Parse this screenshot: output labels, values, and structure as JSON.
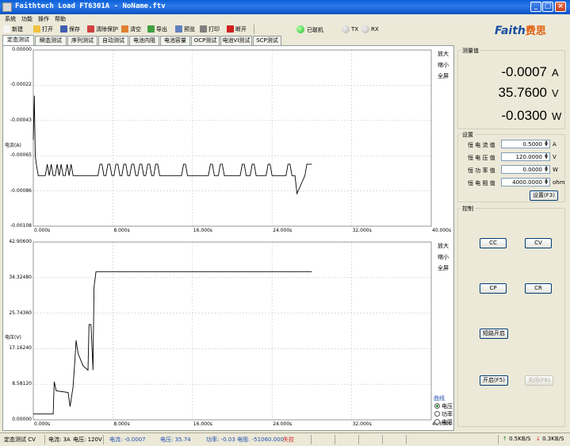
{
  "window": {
    "title": "Faithtech Load FT6301A - NoName.ftv"
  },
  "menu": {
    "items": [
      "系统",
      "功能",
      "操作",
      "帮助"
    ]
  },
  "toolbar": {
    "buttons": [
      {
        "label": "新建",
        "icon": "new-file-icon",
        "color": "#f5f5f5"
      },
      {
        "label": "打开",
        "icon": "open-folder-icon",
        "color": "#f0c040"
      },
      {
        "label": "保存",
        "icon": "save-disk-icon",
        "color": "#4060b0"
      },
      {
        "label": "清除保护",
        "icon": "clear-protect-icon",
        "color": "#d04040"
      },
      {
        "label": "清空",
        "icon": "clear-icon",
        "color": "#e08030"
      },
      {
        "label": "导出",
        "icon": "export-icon",
        "color": "#40a040"
      },
      {
        "label": "预览",
        "icon": "preview-icon",
        "color": "#6080c0"
      },
      {
        "label": "打印",
        "icon": "print-icon",
        "color": "#808080"
      },
      {
        "label": "断开",
        "icon": "disconnect-icon",
        "color": "#d02020"
      }
    ],
    "connected_label": "已联机",
    "tx_label": "TX",
    "rx_label": "RX",
    "led_connected_color": "#20c020",
    "led_idle_color": "#b0b0b0"
  },
  "logo": {
    "text": "Faith",
    "cn": "费思"
  },
  "tabs": [
    "定态测试",
    "瞬态测试",
    "序列测试",
    "自动测试",
    "电池内阻",
    "电池容量",
    "OCP测试",
    "电池VI测试",
    "SCP测试"
  ],
  "active_tab": 0,
  "zoom": {
    "zoom_in": "放大",
    "zoom_out": "缩小",
    "full_screen": "全屏"
  },
  "chart_data": [
    {
      "type": "line",
      "title": "",
      "ylabel": "电流(A)",
      "xlabel": "",
      "x_ticks": [
        "0.000s",
        "8.000s",
        "16.000s",
        "24.000s",
        "32.000s",
        "40.000s"
      ],
      "y_ticks": [
        "0.00000",
        "-0.00022",
        "-0.00043",
        "-0.00065",
        "-0.00086",
        "-0.00108"
      ],
      "xlim": [
        0,
        40
      ],
      "ylim": [
        -0.00108,
        0
      ],
      "grid": true,
      "series": [
        {
          "x": [
            0,
            0.1,
            0.2,
            0.3,
            0.5,
            1.0,
            1.2,
            1.4,
            1.6,
            1.8,
            2.0,
            2.2,
            2.4,
            2.6,
            2.8,
            3.0,
            3.2,
            3.4,
            3.6,
            3.8,
            4.0,
            4.2,
            6.5,
            6.7,
            6.9,
            7.1,
            7.3,
            7.5,
            7.7,
            7.9,
            8.1,
            8.3,
            8.5,
            8.7,
            8.9,
            9.1,
            9.3,
            9.5,
            9.7,
            9.9,
            10.1,
            10.3,
            10.5,
            10.7,
            10.9,
            11.1,
            11.3,
            11.5,
            11.7,
            11.9,
            12.1,
            12.3,
            12.5,
            12.7,
            12.9,
            14.9,
            15.1,
            15.3,
            15.5,
            17.6,
            17.8,
            18.0,
            18.2,
            18.6,
            18.8,
            19.0,
            19.2,
            20.8,
            21.0,
            21.2,
            21.4,
            21.8,
            22.0,
            22.2,
            22.4,
            22.6,
            23.4,
            23.6,
            23.8,
            24.0,
            24.2,
            25.4,
            25.6,
            25.8,
            26.0,
            26.3,
            26.5,
            27.3,
            27.5,
            27.7,
            28.0
          ],
          "y": [
            -0.00055,
            -0.00028,
            -0.00065,
            -0.0007,
            -0.00077,
            -0.00077,
            -0.00077,
            -0.0007,
            -0.00077,
            -0.0007,
            -0.00077,
            -0.00077,
            -0.0007,
            -0.00077,
            -0.0007,
            -0.00077,
            -0.00077,
            -0.0007,
            -0.00077,
            -0.0007,
            -0.00077,
            -0.00077,
            -0.00077,
            -0.0007,
            -0.0007,
            -0.00077,
            -0.00077,
            -0.0007,
            -0.0007,
            -0.00077,
            -0.00077,
            -0.0007,
            -0.0007,
            -0.00077,
            -0.00077,
            -0.0007,
            -0.0007,
            -0.00077,
            -0.00077,
            -0.0007,
            -0.0007,
            -0.00077,
            -0.00077,
            -0.0007,
            -0.0007,
            -0.00077,
            -0.00077,
            -0.0007,
            -0.0007,
            -0.00077,
            -0.00077,
            -0.0007,
            -0.0007,
            -0.00077,
            -0.00077,
            -0.00077,
            -0.0007,
            -0.0007,
            -0.00077,
            -0.00077,
            -0.0007,
            -0.0007,
            -0.00077,
            -0.00077,
            -0.0007,
            -0.0007,
            -0.00077,
            -0.00077,
            -0.0007,
            -0.0007,
            -0.00077,
            -0.00077,
            -0.0007,
            -0.0007,
            -0.00077,
            -0.00077,
            -0.00077,
            -0.0007,
            -0.0007,
            -0.00077,
            -0.00077,
            -0.00077,
            -0.0007,
            -0.0007,
            -0.00077,
            -0.00077,
            -0.00088,
            -0.00077,
            -0.0007,
            -0.0007,
            -0.0007
          ]
        }
      ]
    },
    {
      "type": "line",
      "title": "",
      "ylabel": "电压(V)",
      "xlabel": "",
      "x_ticks": [
        "0.000s",
        "8.000s",
        "16.000s",
        "24.000s",
        "32.000s",
        "40.000s"
      ],
      "y_ticks": [
        "42.90600",
        "34.32480",
        "25.74360",
        "17.16240",
        "8.58120",
        "0.00000"
      ],
      "xlim": [
        0,
        40
      ],
      "ylim": [
        0,
        42.906
      ],
      "grid": true,
      "series": [
        {
          "x": [
            0,
            2.0,
            2.1,
            2.3,
            3.5,
            3.7,
            4.0,
            4.2,
            4.3,
            4.5,
            5.0,
            5.5,
            5.6,
            5.8,
            6.0,
            6.1,
            6.3,
            28.0
          ],
          "y": [
            1.4,
            1.4,
            9.2,
            7.0,
            6.6,
            3.2,
            8.0,
            15.0,
            19.2,
            16.0,
            13.0,
            12.0,
            23.0,
            23.0,
            12.0,
            32.0,
            35.76,
            35.76
          ]
        }
      ]
    }
  ],
  "curve_legend": {
    "title": "曲线",
    "options": [
      "电压",
      "功率",
      "电阻"
    ],
    "selected": 0
  },
  "measure": {
    "title": "测量值",
    "current": "-0.0007",
    "current_unit": "A",
    "voltage": "35.7600",
    "voltage_unit": "V",
    "power": "-0.0300",
    "power_unit": "W"
  },
  "settings": {
    "title": "设置",
    "rows": [
      {
        "label": "恒 电 流 值",
        "value": "0.5000",
        "unit": "A"
      },
      {
        "label": "恒 电 压 值",
        "value": "120.0000",
        "unit": "V"
      },
      {
        "label": "恒 功 率 值",
        "value": "0.0000",
        "unit": "W"
      },
      {
        "label": "恒 电 阻 值",
        "value": "4000.0000",
        "unit": "ohm"
      }
    ],
    "apply_label": "设置(F3)"
  },
  "control": {
    "title": "控制",
    "cc": "CC",
    "cv": "CV",
    "cp": "CP",
    "cr": "CR",
    "protect": "短路开启",
    "start": "开启(F5)",
    "stop": "关闭(F6)"
  },
  "status": {
    "mode": "定态测试 CV",
    "current_set": "电流: 3A",
    "voltage_set": "电压: 120V",
    "current": "电流: -0.0007",
    "voltage": "电压: 35.74",
    "power": "功率: -0.03",
    "resistance": "电阻: -51060.000",
    "state": "失控",
    "state_color": "#d02020",
    "tx_rate": "0.5KB/S",
    "rx_rate": "0.3KB/S"
  }
}
